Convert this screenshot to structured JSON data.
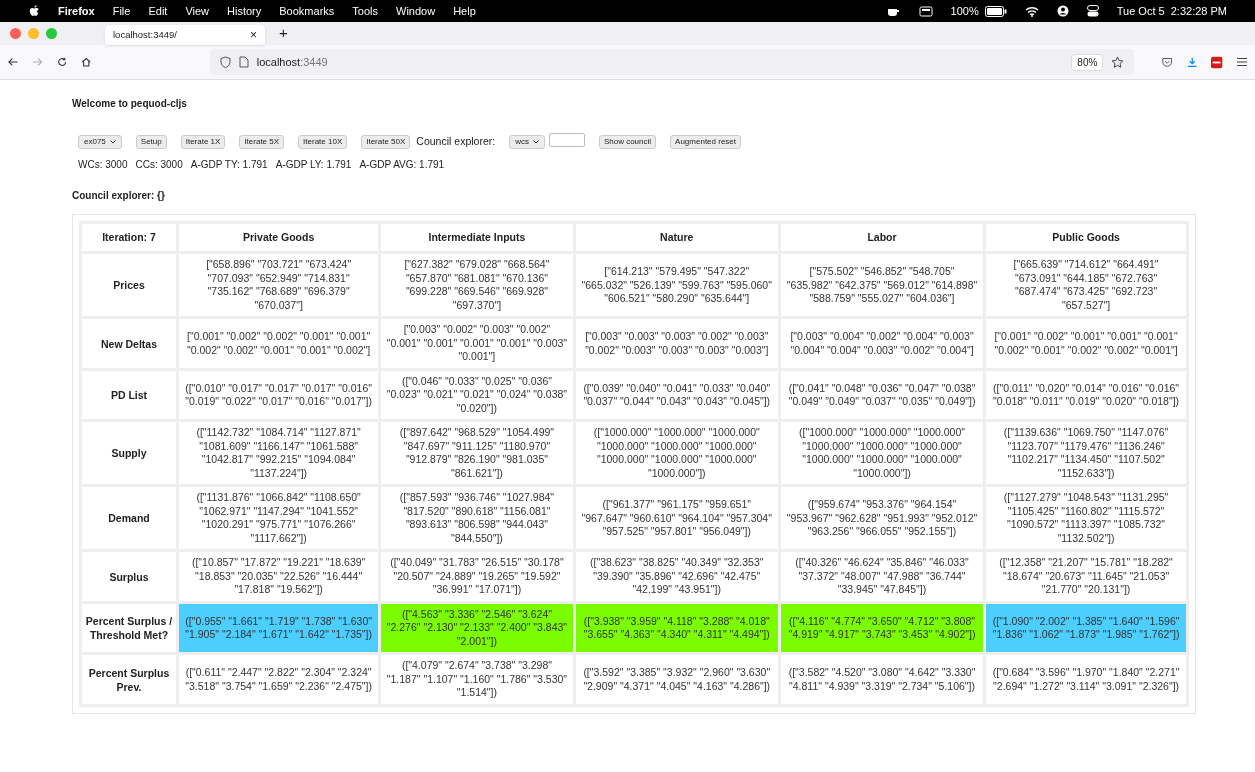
{
  "menubar": {
    "app": "Firefox",
    "menus": [
      "File",
      "Edit",
      "View",
      "History",
      "Bookmarks",
      "Tools",
      "Window",
      "Help"
    ],
    "battery": "100%",
    "clock": "Tue Oct 5  2:32:28 PM"
  },
  "browser": {
    "tab": {
      "title": "localhost:3449/",
      "close": "×"
    },
    "new_tab": "+",
    "url_host": "localhost",
    "url_port": ":3449",
    "zoom": "80%"
  },
  "page": {
    "heading": "Welcome to pequod-cljs",
    "controls": [
      {
        "kind": "select",
        "value": "ex075"
      },
      {
        "kind": "button",
        "label": "Setup"
      },
      {
        "kind": "button",
        "label": "Iterate 1X"
      },
      {
        "kind": "button",
        "label": "Iterate 5X"
      },
      {
        "kind": "button",
        "label": "Iterate 10X"
      },
      {
        "kind": "button",
        "label": "Iterate 50X"
      },
      {
        "kind": "text",
        "label": "Council explorer:"
      },
      {
        "kind": "select",
        "value": "wcs"
      },
      {
        "kind": "input"
      },
      {
        "kind": "button",
        "label": "Show council"
      },
      {
        "kind": "button",
        "label": "Augmented reset"
      }
    ],
    "stats": [
      "WCs: 3000",
      "CCs: 3000",
      "A-GDP TY: 1.791",
      "A-GDP LY: 1.791",
      "A-GDP AVG: 1.791"
    ],
    "council_heading": "Council explorer: {}"
  },
  "table": {
    "corner": "Iteration: 7",
    "columns": [
      "Private Goods",
      "Intermediate Inputs",
      "Nature",
      "Labor",
      "Public Goods"
    ],
    "rows": [
      {
        "label": "Prices",
        "cells": [
          {
            "text": "[\"658.896\" \"703.721\" \"673.424\" \"707.093\" \"652.949\" \"714.831\" \"735.162\" \"768.689\" \"696.379\" \"670.037\"]"
          },
          {
            "text": "[\"627.382\" \"679.028\" \"668.564\" \"657.870\" \"681.081\" \"670.136\" \"699.228\" \"669.546\" \"669.928\" \"697.370\"]"
          },
          {
            "text": "[\"614.213\" \"579.495\" \"547.322\" \"665.032\" \"526.139\" \"599.763\" \"595.060\" \"606.521\" \"580.290\" \"635.644\"]"
          },
          {
            "text": "[\"575.502\" \"546.852\" \"548.705\" \"635.982\" \"642.375\" \"569.012\" \"614.898\" \"588.759\" \"555.027\" \"604.036\"]"
          },
          {
            "text": "[\"665.639\" \"714.612\" \"664.491\" \"673.091\" \"644.185\" \"672.763\" \"687.474\" \"673.425\" \"692.723\" \"657.527\"]"
          }
        ]
      },
      {
        "label": "New Deltas",
        "cells": [
          {
            "text": "[\"0.001\" \"0.002\" \"0.002\" \"0.001\" \"0.001\" \"0.002\" \"0.002\" \"0.001\" \"0.001\" \"0.002\"]"
          },
          {
            "text": "[\"0.003\" \"0.002\" \"0.003\" \"0.002\" \"0.001\" \"0.001\" \"0.001\" \"0.001\" \"0.003\" \"0.001\"]"
          },
          {
            "text": "[\"0.003\" \"0.003\" \"0.003\" \"0.002\" \"0.003\" \"0.002\" \"0.003\" \"0.003\" \"0.003\" \"0.003\"]"
          },
          {
            "text": "[\"0.003\" \"0.004\" \"0.002\" \"0.004\" \"0.003\" \"0.004\" \"0.004\" \"0.003\" \"0.002\" \"0.004\"]"
          },
          {
            "text": "[\"0.001\" \"0.002\" \"0.001\" \"0.001\" \"0.001\" \"0.002\" \"0.001\" \"0.002\" \"0.002\" \"0.001\"]"
          }
        ]
      },
      {
        "label": "PD List",
        "cells": [
          {
            "text": "([\"0.010\" \"0.017\" \"0.017\" \"0.017\" \"0.016\" \"0.019\" \"0.022\" \"0.017\" \"0.016\" \"0.017\"])"
          },
          {
            "text": "([\"0.046\" \"0.033\" \"0.025\" \"0.036\" \"0.023\" \"0.021\" \"0.021\" \"0.024\" \"0.038\" \"0.020\"])"
          },
          {
            "text": "([\"0.039\" \"0.040\" \"0.041\" \"0.033\" \"0.040\" \"0.037\" \"0.044\" \"0.043\" \"0.043\" \"0.045\"])"
          },
          {
            "text": "([\"0.041\" \"0.048\" \"0.036\" \"0.047\" \"0.038\" \"0.049\" \"0.049\" \"0.037\" \"0.035\" \"0.049\"])"
          },
          {
            "text": "([\"0.011\" \"0.020\" \"0.014\" \"0.016\" \"0.016\" \"0.018\" \"0.011\" \"0.019\" \"0.020\" \"0.018\"])"
          }
        ]
      },
      {
        "label": "Supply",
        "cells": [
          {
            "text": "([\"1142.732\" \"1084.714\" \"1127.871\" \"1081.609\" \"1166.147\" \"1061.588\" \"1042.817\" \"992.215\" \"1094.084\" \"1137.224\"])"
          },
          {
            "text": "([\"897.642\" \"968.529\" \"1054.499\" \"847.697\" \"911.125\" \"1180.970\" \"912.879\" \"826.190\" \"981.035\" \"861.621\"])"
          },
          {
            "text": "([\"1000.000\" \"1000.000\" \"1000.000\" \"1000.000\" \"1000.000\" \"1000.000\" \"1000.000\" \"1000.000\" \"1000.000\" \"1000.000\"])"
          },
          {
            "text": "([\"1000.000\" \"1000.000\" \"1000.000\" \"1000.000\" \"1000.000\" \"1000.000\" \"1000.000\" \"1000.000\" \"1000.000\" \"1000.000\"])"
          },
          {
            "text": "([\"1139.636\" \"1069.750\" \"1147.076\" \"1123.707\" \"1179.476\" \"1136.246\" \"1102.217\" \"1134.450\" \"1107.502\" \"1152.633\"])"
          }
        ]
      },
      {
        "label": "Demand",
        "cells": [
          {
            "text": "([\"1131.876\" \"1066.842\" \"1108.650\" \"1062.971\" \"1147.294\" \"1041.552\" \"1020.291\" \"975.771\" \"1076.266\" \"1117.662\"])"
          },
          {
            "text": "([\"857.593\" \"936.746\" \"1027.984\" \"817.520\" \"890.618\" \"1156.081\" \"893.613\" \"806.598\" \"944.043\" \"844.550\"])"
          },
          {
            "text": "([\"961.377\" \"961.175\" \"959.651\" \"967.647\" \"960.610\" \"964.104\" \"957.304\" \"957.525\" \"957.801\" \"956.049\"])"
          },
          {
            "text": "([\"959.674\" \"953.376\" \"964.154\" \"953.967\" \"962.628\" \"951.993\" \"952.012\" \"963.256\" \"966.055\" \"952.155\"])"
          },
          {
            "text": "([\"1127.279\" \"1048.543\" \"1131.295\" \"1105.425\" \"1160.802\" \"1115.572\" \"1090.572\" \"1113.397\" \"1085.732\" \"1132.502\"])"
          }
        ]
      },
      {
        "label": "Surplus",
        "cells": [
          {
            "text": "([\"10.857\" \"17.872\" \"19.221\" \"18.639\" \"18.853\" \"20.035\" \"22.526\" \"16.444\" \"17.818\" \"19.562\"])"
          },
          {
            "text": "([\"40.049\" \"31.783\" \"26.515\" \"30.178\" \"20.507\" \"24.889\" \"19.265\" \"19.592\" \"36.991\" \"17.071\"])"
          },
          {
            "text": "([\"38.623\" \"38.825\" \"40.349\" \"32.353\" \"39.390\" \"35.896\" \"42.696\" \"42.475\" \"42.199\" \"43.951\"])"
          },
          {
            "text": "([\"40.326\" \"46.624\" \"35.846\" \"46.033\" \"37.372\" \"48.007\" \"47.988\" \"36.744\" \"33.945\" \"47.845\"])"
          },
          {
            "text": "([\"12.358\" \"21.207\" \"15.781\" \"18.282\" \"18.674\" \"20.673\" \"11.645\" \"21.053\" \"21.770\" \"20.131\"])"
          }
        ]
      },
      {
        "label": "Percent Surplus / Threshold Met?",
        "cells": [
          {
            "text": "([\"0.955\" \"1.661\" \"1.719\" \"1.738\" \"1.630\" \"1.905\" \"2.184\" \"1.671\" \"1.642\" \"1.735\"])",
            "color": "#4ccefe"
          },
          {
            "text": "([\"4.563\" \"3.336\" \"2.546\" \"3.624\" \"2.276\" \"2.130\" \"2.133\" \"2.400\" \"3.843\" \"2.001\"])",
            "color": "#7cfc00"
          },
          {
            "text": "([\"3.938\" \"3.959\" \"4.118\" \"3.288\" \"4.018\" \"3.655\" \"4.363\" \"4.340\" \"4.311\" \"4.494\"])",
            "color": "#7cfc00"
          },
          {
            "text": "([\"4.116\" \"4.774\" \"3.650\" \"4.712\" \"3.808\" \"4.919\" \"4.917\" \"3.743\" \"3.453\" \"4.902\"])",
            "color": "#7cfc00"
          },
          {
            "text": "([\"1.090\" \"2.002\" \"1.385\" \"1.640\" \"1.596\" \"1.836\" \"1.062\" \"1.873\" \"1.985\" \"1.762\"])",
            "color": "#4ccefe"
          }
        ]
      },
      {
        "label": "Percent Surplus Prev.",
        "cells": [
          {
            "text": "([\"0.611\" \"2.447\" \"2.822\" \"2.304\" \"2.324\" \"3.518\" \"3.754\" \"1.659\" \"2.236\" \"2.475\"])"
          },
          {
            "text": "([\"4.079\" \"2.674\" \"3.738\" \"3.298\" \"1.187\" \"1.107\" \"1.160\" \"1.786\" \"3.530\" \"1.514\"])"
          },
          {
            "text": "([\"3.592\" \"3.385\" \"3.932\" \"2.960\" \"3.630\" \"2.909\" \"4.371\" \"4.045\" \"4.163\" \"4.286\"])"
          },
          {
            "text": "([\"3.582\" \"4.520\" \"3.080\" \"4.642\" \"3.330\" \"4.811\" \"4.939\" \"3.319\" \"2.734\" \"5.106\"])"
          },
          {
            "text": "([\"0.684\" \"3.596\" \"1.970\" \"1.840\" \"2.271\" \"2.694\" \"1.272\" \"3.114\" \"3.091\" \"2.326\"])"
          }
        ]
      }
    ]
  }
}
